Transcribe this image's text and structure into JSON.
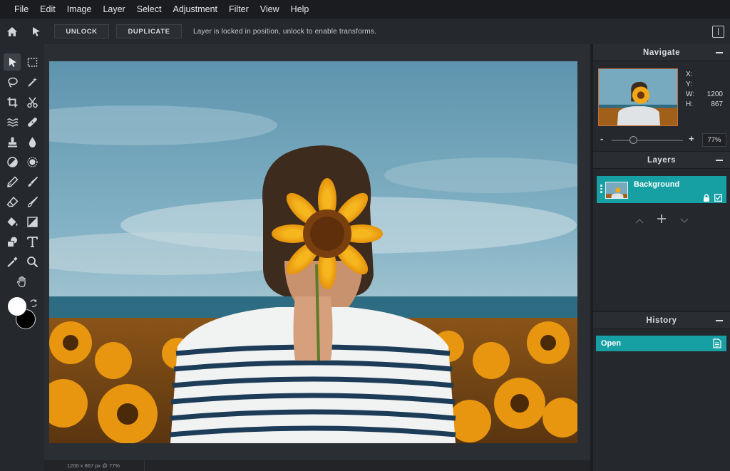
{
  "menu": [
    "File",
    "Edit",
    "Image",
    "Layer",
    "Select",
    "Adjustment",
    "Filter",
    "View",
    "Help"
  ],
  "options_bar": {
    "unlock_label": "UNLOCK",
    "duplicate_label": "DUPLICATE",
    "message": "Layer is locked in position, unlock to enable transforms."
  },
  "status": {
    "info": "1200 x 867 px @ 77%"
  },
  "navigate": {
    "title": "Navigate",
    "x_label": "X:",
    "x_value": "",
    "y_label": "Y:",
    "y_value": "",
    "w_label": "W:",
    "w_value": "1200",
    "h_label": "H:",
    "h_value": "867",
    "zoom_minus": "-",
    "zoom_plus": "+",
    "zoom_value": "77%",
    "zoom_level_fraction": 0.3
  },
  "layers": {
    "title": "Layers",
    "items": [
      {
        "name": "Background",
        "locked": true,
        "visible": true
      }
    ]
  },
  "history": {
    "title": "History",
    "items": [
      {
        "name": "Open"
      }
    ]
  },
  "colors": {
    "accent": "#17a0a3",
    "foreground": "#ffffff",
    "background": "#000000"
  },
  "icons": {
    "home": "home-icon",
    "pointer": "pointer-icon",
    "panel_toggle": "panel-toggle-icon"
  }
}
